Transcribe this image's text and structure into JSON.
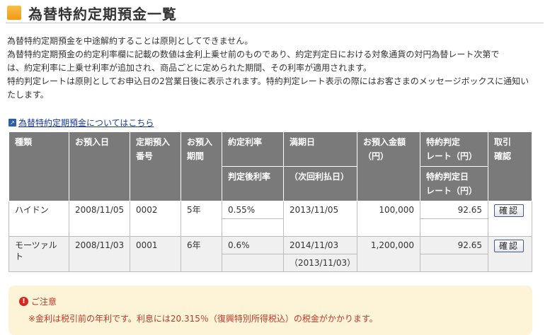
{
  "title": "為替特約定期預金一覧",
  "intro": [
    "為替特約定期預金を中途解約することは原則としてできません。",
    "為替特約定期預金の約定利率欄に記載の数値は金利上乗せ前のものであり、約定判定日における対象通貨の対円為替レート次第で",
    "は、約定利率に上乗せ利率が追加され、商品ごとに定められた期間、その利率が適用されます。",
    "特約判定レートは原則としてお申込日の2営業日後に表示されます。特約判定レート表示の際にはお客さまのメッセージボックスに通知い",
    "たします。"
  ],
  "link": {
    "icon": "external-link-icon",
    "text": "為替特約定期預金についてはこちら"
  },
  "table": {
    "headers": {
      "kind": "種類",
      "deposit_date": "お預入日",
      "number_1": "定期預入",
      "number_2": "番号",
      "period_1": "お預入",
      "period_2": "期間",
      "rate": "約定利率",
      "rate_after": "判定後利率",
      "maturity": "満期日",
      "next_interest": "（次回利払日）",
      "amount_1": "お預入金額",
      "amount_2": "（円）",
      "rate_rate_1": "特約判定",
      "rate_rate_2": "レート（円）",
      "rate_date_1": "特約判定日",
      "rate_date_2": "レート（円）",
      "action_1": "取引",
      "action_2": "確認"
    },
    "rows": [
      {
        "kind": "ハイドン",
        "deposit_date": "2008/11/05",
        "number": "0002",
        "period": "5年",
        "rate": "0.55%",
        "rate_after": "",
        "maturity": "2013/11/05",
        "next_interest": "",
        "amount": "100,000",
        "special_rate": "92.65",
        "special_date_rate": "",
        "button": "確認"
      },
      {
        "kind": "モーツァルト",
        "deposit_date": "2008/11/03",
        "number": "0001",
        "period": "6年",
        "rate": "0.6%",
        "rate_after": "",
        "maturity": "2014/11/03",
        "next_interest": "（2013/11/03）",
        "amount": "1,200,000",
        "special_rate": "92.65",
        "special_date_rate": "",
        "button": "確認"
      }
    ]
  },
  "notice": {
    "icon": "exclamation-icon",
    "heading": "ご注意",
    "line": "※金利は税引前の年利です。利息には20.315％（復興特別所得税込）の税金がかかります。"
  },
  "colors": {
    "header_bg": "#7a7a7a",
    "accent": "#f5a623",
    "link": "#1a3a9a",
    "notice_bg": "#fdf3d6",
    "warning": "#c0392b"
  }
}
